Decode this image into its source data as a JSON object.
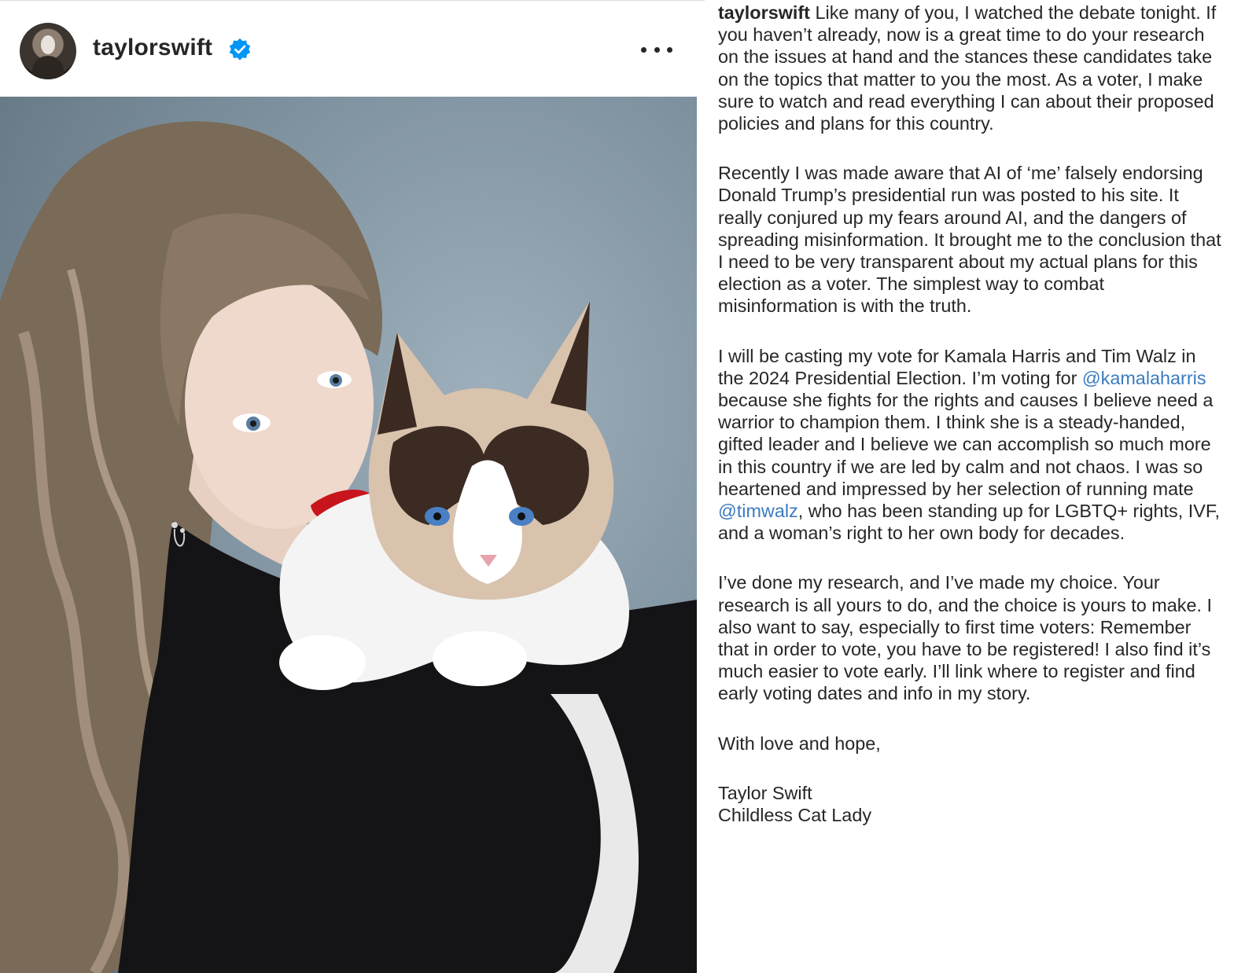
{
  "post": {
    "username": "taylorswift",
    "verified": true,
    "more_icon": "more-horizontal-icon",
    "photo_alt": "photo"
  },
  "caption": {
    "username": "taylorswift",
    "p1": " Like many of you, I watched the debate tonight. If you haven’t already, now is a great time to do your research on the issues at hand and the stances these candidates take on the topics that matter to you the most. As a voter, I make sure to watch and read everything I can about their proposed policies and plans for this country.",
    "p2": "Recently I was made aware that AI of ‘me’ falsely endorsing Donald Trump’s presidential run was posted to his site. It really conjured up my fears around AI, and the dangers of spreading misinformation. It brought me to the conclusion that I need to be very transparent about my actual plans for this election as a voter. The simplest way to combat misinformation is with the truth.",
    "p3a": "I will be casting my vote for Kamala Harris and Tim Walz in the 2024 Presidential Election. I’m voting for ",
    "mention1": "@kamalaharris",
    "p3b": " because she fights for the rights and causes I believe need a warrior to champion them. I think she is a steady-handed, gifted leader and I believe we can accomplish so much more in this country if we are led by calm and not chaos. I was so heartened and impressed by her selection of running mate ",
    "mention2": "@timwalz",
    "p3c": ", who has been standing up for LGBTQ+ rights, IVF, and a woman’s right to her own body for decades.",
    "p4": "I’ve done my research, and I’ve made my choice. Your research is all yours to do, and the choice is yours to make. I also want to say, especially to first time voters: Remember that in order to vote, you have to be registered! I also find it’s much easier to vote early. I’ll link where to register and find early voting dates and info in my story.",
    "p5": "With love and hope,",
    "sign1": "Taylor Swift",
    "sign2": "Childless Cat Lady"
  },
  "colors": {
    "mention": "#3b7bbf",
    "verified": "#0095f6",
    "text": "#262626"
  }
}
